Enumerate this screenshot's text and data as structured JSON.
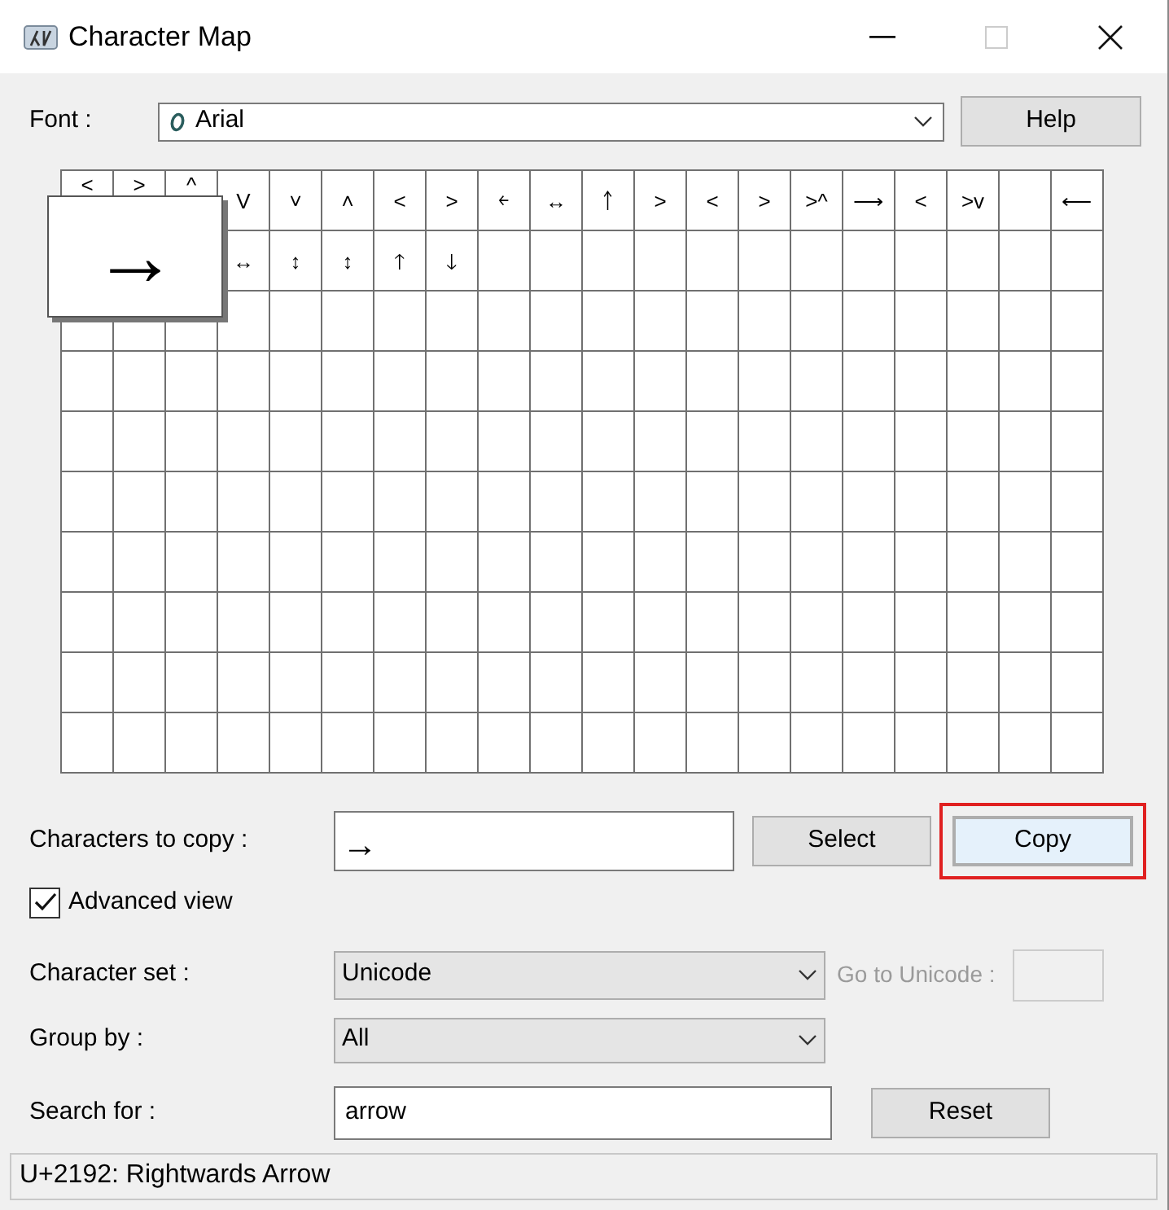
{
  "window": {
    "title": "Character Map"
  },
  "font": {
    "label": "Font :",
    "value": "Arial"
  },
  "help_button": "Help",
  "grid": {
    "rows": [
      [
        "<",
        ">",
        "^",
        "V",
        "˅",
        "˄",
        "˂",
        "˃",
        "￩",
        "↔",
        "￪",
        "˃",
        "˂",
        "˃",
        "˃^",
        "⟶",
        "˂",
        "˃v",
        null,
        "⟵"
      ],
      [
        null,
        null,
        null,
        "↔",
        "↕",
        "↕",
        "🡑",
        "🡓",
        null,
        null,
        null,
        null,
        null,
        null,
        null,
        null,
        null,
        null,
        null,
        null
      ],
      [
        null,
        null,
        null,
        null,
        null,
        null,
        null,
        null,
        null,
        null,
        null,
        null,
        null,
        null,
        null,
        null,
        null,
        null,
        null,
        null
      ],
      [
        null,
        null,
        null,
        null,
        null,
        null,
        null,
        null,
        null,
        null,
        null,
        null,
        null,
        null,
        null,
        null,
        null,
        null,
        null,
        null
      ],
      [
        null,
        null,
        null,
        null,
        null,
        null,
        null,
        null,
        null,
        null,
        null,
        null,
        null,
        null,
        null,
        null,
        null,
        null,
        null,
        null
      ],
      [
        null,
        null,
        null,
        null,
        null,
        null,
        null,
        null,
        null,
        null,
        null,
        null,
        null,
        null,
        null,
        null,
        null,
        null,
        null,
        null
      ],
      [
        null,
        null,
        null,
        null,
        null,
        null,
        null,
        null,
        null,
        null,
        null,
        null,
        null,
        null,
        null,
        null,
        null,
        null,
        null,
        null
      ],
      [
        null,
        null,
        null,
        null,
        null,
        null,
        null,
        null,
        null,
        null,
        null,
        null,
        null,
        null,
        null,
        null,
        null,
        null,
        null,
        null
      ],
      [
        null,
        null,
        null,
        null,
        null,
        null,
        null,
        null,
        null,
        null,
        null,
        null,
        null,
        null,
        null,
        null,
        null,
        null,
        null,
        null
      ],
      [
        null,
        null,
        null,
        null,
        null,
        null,
        null,
        null,
        null,
        null,
        null,
        null,
        null,
        null,
        null,
        null,
        null,
        null,
        null,
        null
      ]
    ],
    "magnified": "→"
  },
  "copy": {
    "label": "Characters to copy :",
    "value": "→",
    "select_button": "Select",
    "copy_button": "Copy",
    "copy_highlighted": true
  },
  "advanced_view": {
    "label": "Advanced view",
    "checked": true
  },
  "character_set": {
    "label": "Character set :",
    "value": "Unicode",
    "goto_label": "Go to Unicode :",
    "goto_disabled": true
  },
  "group_by": {
    "label": "Group by :",
    "value": "All"
  },
  "search": {
    "label": "Search for :",
    "value": "arrow",
    "reset_button": "Reset"
  },
  "status_bar": "U+2192: Rightwards Arrow"
}
